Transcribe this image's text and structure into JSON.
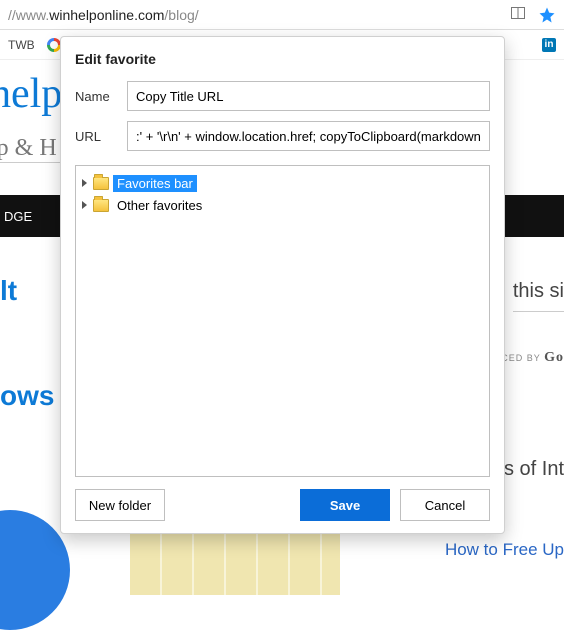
{
  "addressbar": {
    "visible_url_gray1": "//www.",
    "visible_url_dark": "winhelponline.com",
    "visible_url_gray2": "/blog/"
  },
  "bookmarks_bar": {
    "items": [
      "TWB"
    ],
    "linkedin_glyph": "in"
  },
  "background": {
    "logo_fragment": "help",
    "script_fragment": "lp & H",
    "blackbar_fragment": "DGE",
    "left_word1": "lt",
    "left_word2": "ows",
    "right_text1": " this si",
    "right_text2_prefix": "NCED BY ",
    "right_text2_brand": "Go",
    "right_text3": "s of Int",
    "right_link": "How to Free Up "
  },
  "dialog": {
    "title": "Edit favorite",
    "name_label": "Name",
    "name_value": "Copy Title URL",
    "url_label": "URL",
    "url_value": ":' + '\\r\\n' + window.location.href; copyToClipboard(markdown); })();",
    "tree": {
      "items": [
        {
          "label": "Favorites bar",
          "selected": true
        },
        {
          "label": "Other favorites",
          "selected": false
        }
      ]
    },
    "buttons": {
      "new_folder": "New folder",
      "save": "Save",
      "cancel": "Cancel"
    }
  }
}
